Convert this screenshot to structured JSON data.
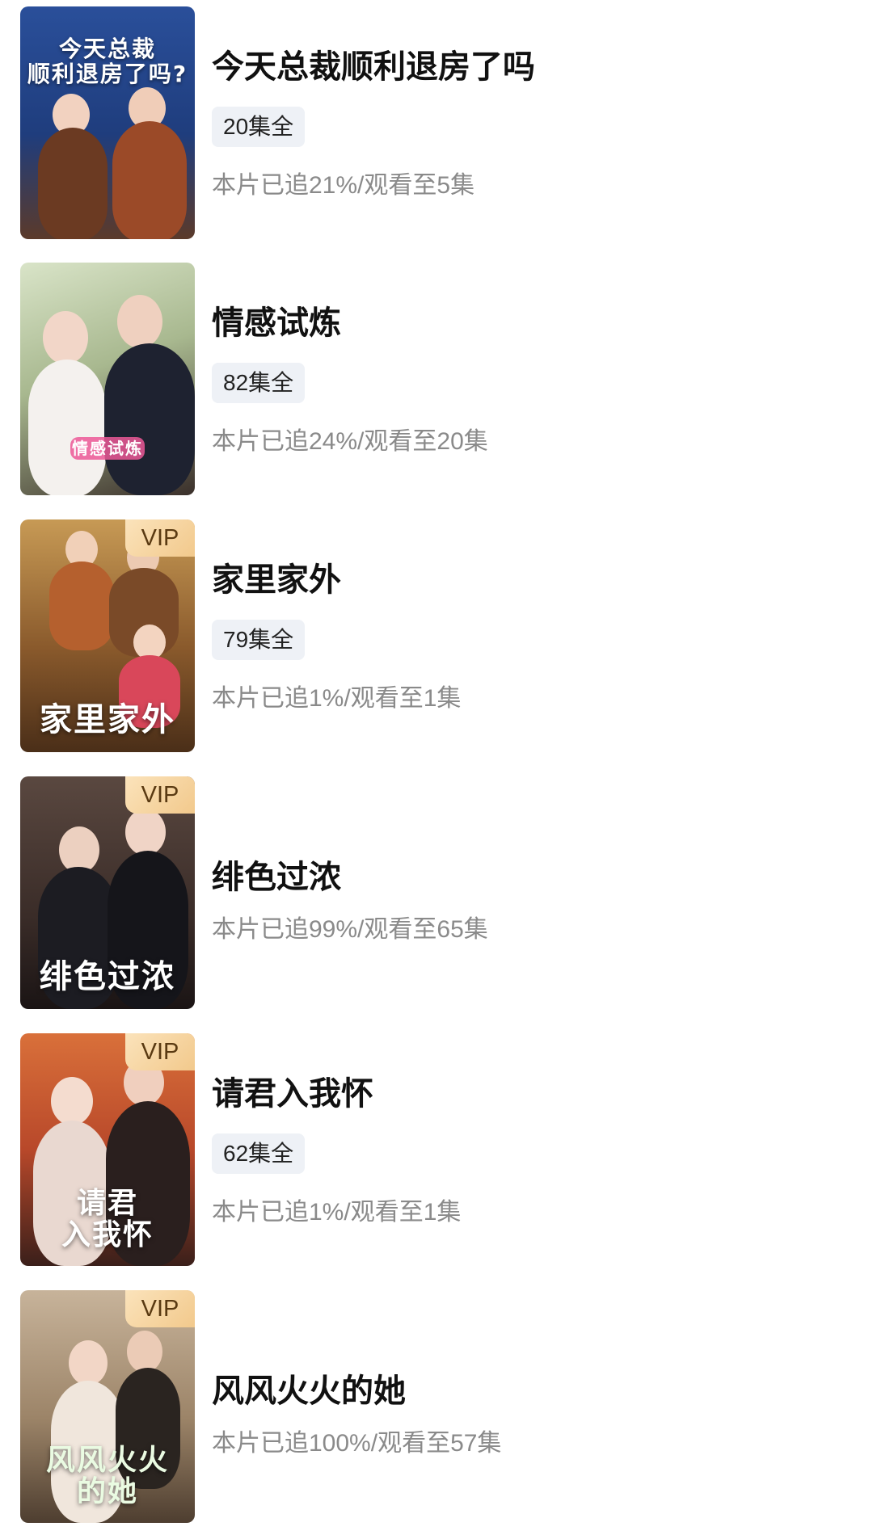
{
  "items": [
    {
      "title": "今天总裁顺利退房了吗",
      "episodes": "20集全",
      "progress": "本片已追21%/观看至5集",
      "vip": false,
      "poster_art_text": "今天总裁\n顺利退房了吗?"
    },
    {
      "title": "情感试炼",
      "episodes": "82集全",
      "progress": "本片已追24%/观看至20集",
      "vip": false,
      "poster_art_text": "情感试炼"
    },
    {
      "title": "家里家外",
      "episodes": "79集全",
      "progress": "本片已追1%/观看至1集",
      "vip": true,
      "vip_label": "VIP",
      "poster_art_text": "家里家外"
    },
    {
      "title": "绯色过浓",
      "progress": "本片已追99%/观看至65集",
      "vip": true,
      "vip_label": "VIP",
      "poster_art_text": "绯色过浓"
    },
    {
      "title": "请君入我怀",
      "episodes": "62集全",
      "progress": "本片已追1%/观看至1集",
      "vip": true,
      "vip_label": "VIP",
      "poster_art_text": "请君\n入我怀"
    },
    {
      "title": "风风火火的她",
      "progress": "本片已追100%/观看至57集",
      "vip": true,
      "vip_label": "VIP",
      "poster_art_text": "风风火火\n的她"
    }
  ],
  "colors": {
    "badge_bg": "#eef1f6",
    "vip_gold": "#f2c98c",
    "progress_text": "#8a8a8a",
    "title_text": "#111111"
  },
  "icons": {
    "vip_badge": "vip-badge"
  }
}
